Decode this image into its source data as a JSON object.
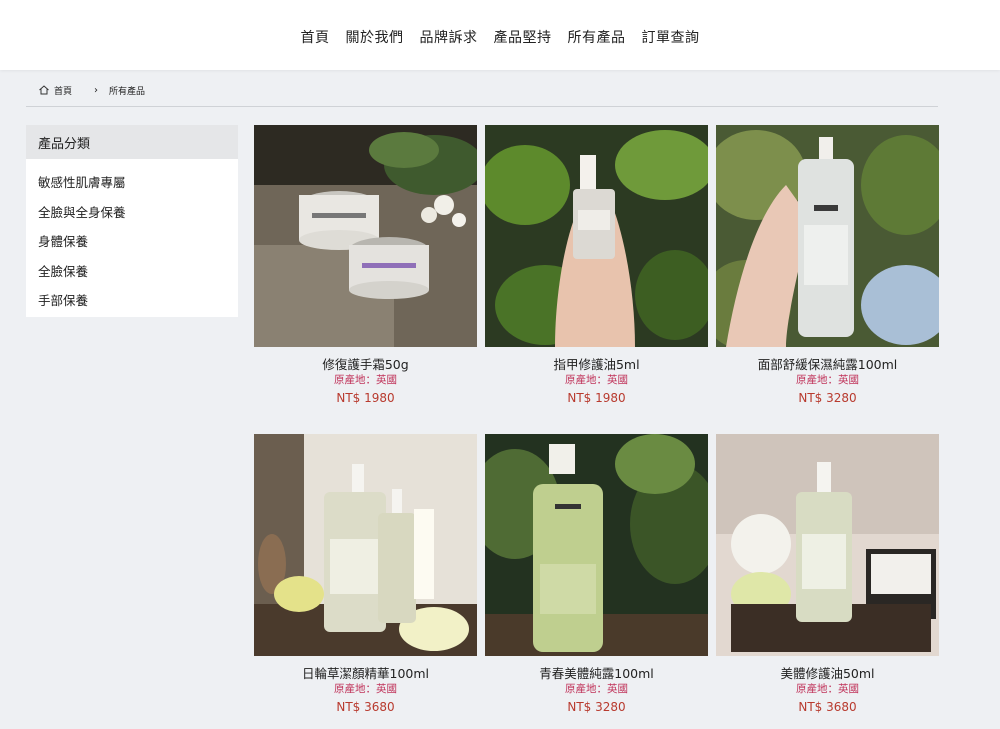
{
  "nav": {
    "items": [
      "首頁",
      "關於我們",
      "品牌訴求",
      "產品堅持",
      "所有產品",
      "訂單查詢"
    ]
  },
  "breadcrumb": {
    "home_icon": "home-icon",
    "home": "首頁",
    "separator": "›",
    "current": "所有產品"
  },
  "sidebar": {
    "title": "產品分類",
    "items": [
      "敏感性肌膚專屬",
      "全臉與全身保養",
      "身體保養",
      "全臉保養",
      "手部保養"
    ]
  },
  "products": [
    {
      "name": "修復護手霜50g",
      "origin": "原產地：英國",
      "price": "NT$ 1980",
      "image": "hand-cream-jars-photo"
    },
    {
      "name": "指甲修護油5ml",
      "origin": "原產地：英國",
      "price": "NT$ 1980",
      "image": "nail-oil-bottle-photo"
    },
    {
      "name": "面部舒緩保濕純露100ml",
      "origin": "原產地：英國",
      "price": "NT$ 3280",
      "image": "face-mist-spray-photo"
    },
    {
      "name": "日輪草潔顏精華100ml",
      "origin": "原產地：英國",
      "price": "NT$ 3680",
      "image": "cleansing-oil-bottles-photo"
    },
    {
      "name": "青春美體純露100ml",
      "origin": "原產地：英國",
      "price": "NT$ 3280",
      "image": "body-mist-spray-photo"
    },
    {
      "name": "美體修護油50ml",
      "origin": "原產地：英國",
      "price": "NT$ 3680",
      "image": "body-oil-dropper-photo"
    }
  ],
  "colors": {
    "origin_text": "#c0335a",
    "price_text": "#b83a2e",
    "page_bg": "#eef0f3"
  }
}
